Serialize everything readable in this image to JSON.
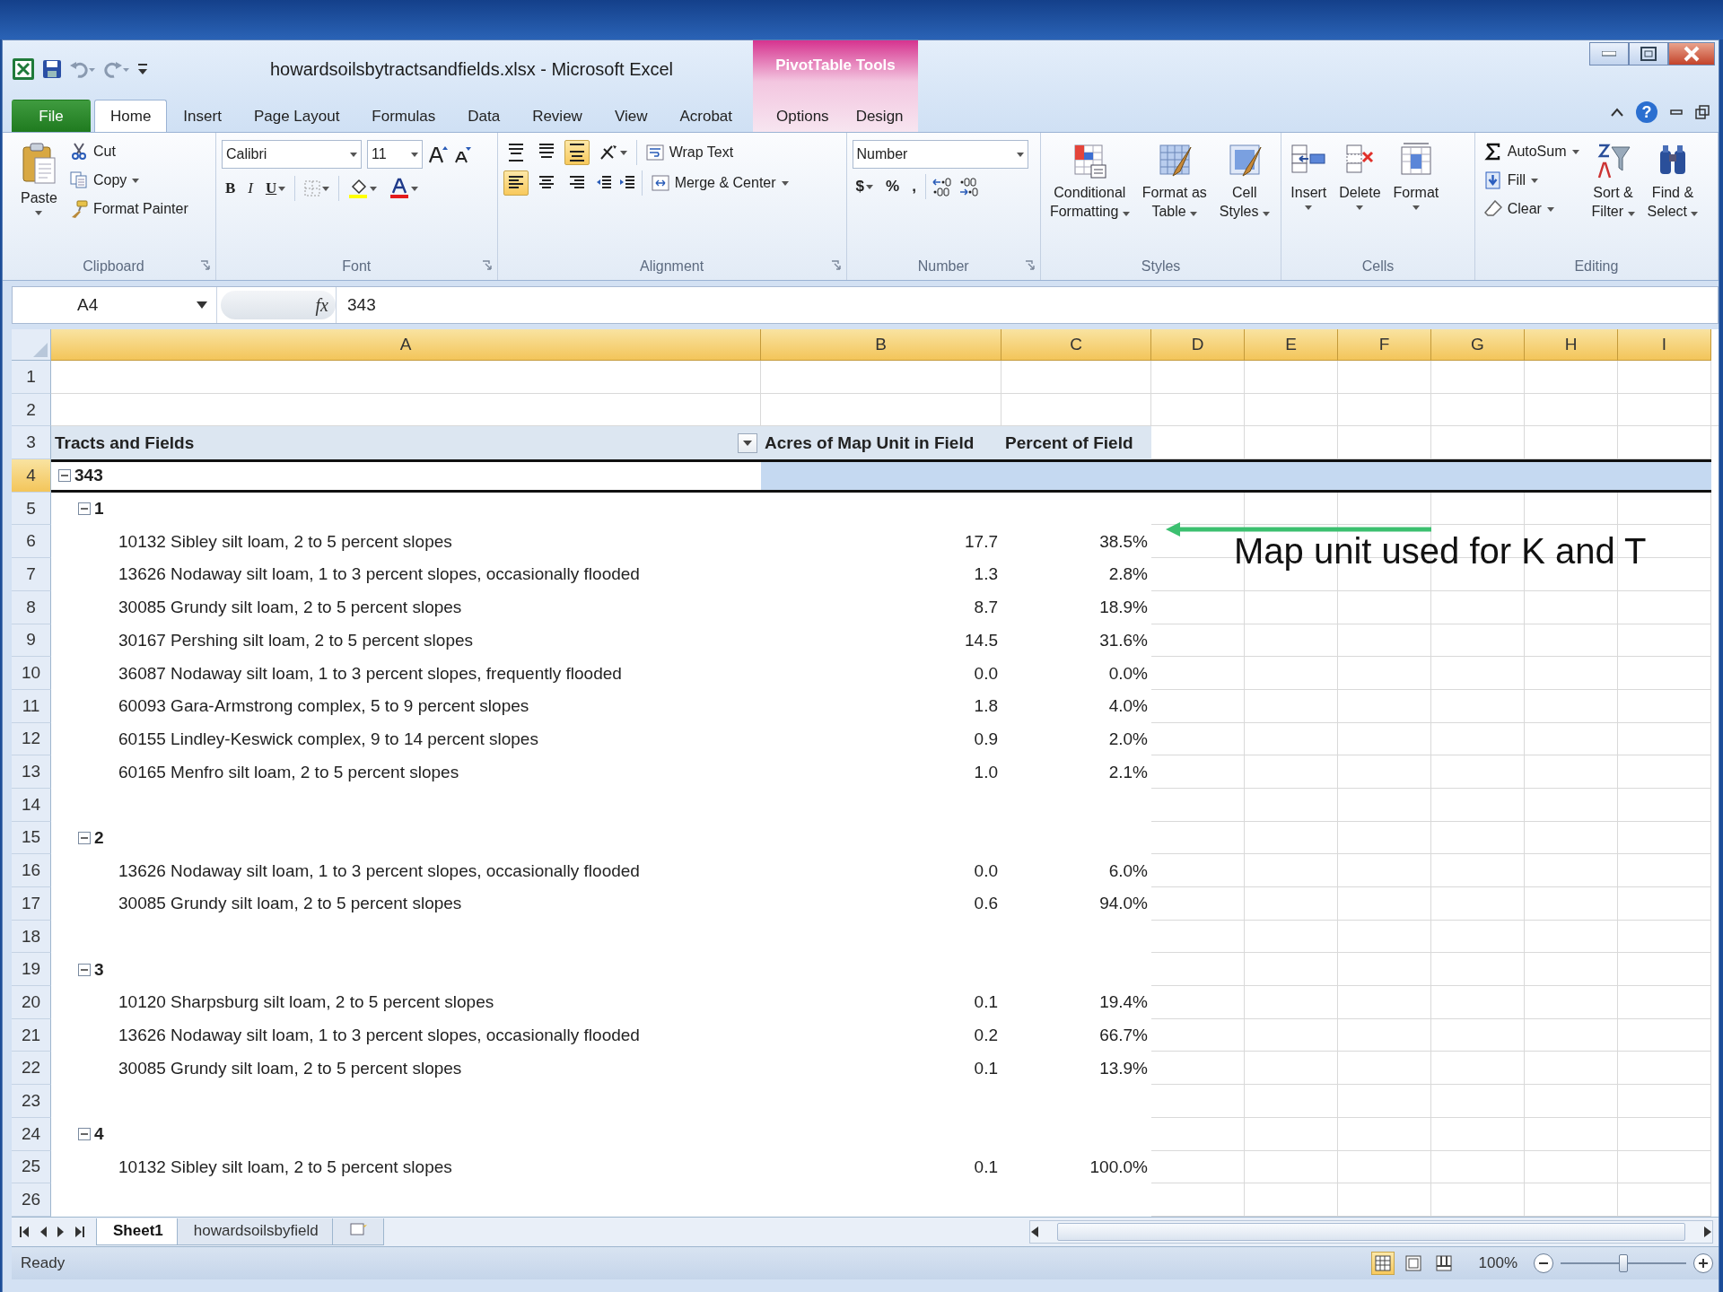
{
  "app": {
    "title": "howardsoilsbytractsandfields.xlsx  -  Microsoft Excel",
    "context_group": "PivotTable Tools",
    "help": "?"
  },
  "ribbon_tabs": [
    {
      "label": "File",
      "kind": "file",
      "selected": false
    },
    {
      "label": "Home",
      "kind": "tab",
      "selected": true
    },
    {
      "label": "Insert",
      "kind": "tab",
      "selected": false
    },
    {
      "label": "Page Layout",
      "kind": "tab",
      "selected": false
    },
    {
      "label": "Formulas",
      "kind": "tab",
      "selected": false
    },
    {
      "label": "Data",
      "kind": "tab",
      "selected": false
    },
    {
      "label": "Review",
      "kind": "tab",
      "selected": false
    },
    {
      "label": "View",
      "kind": "tab",
      "selected": false
    },
    {
      "label": "Acrobat",
      "kind": "tab",
      "selected": false
    },
    {
      "label": "Options",
      "kind": "context",
      "selected": false
    },
    {
      "label": "Design",
      "kind": "context",
      "selected": false
    }
  ],
  "ribbon": {
    "clipboard": {
      "label": "Clipboard",
      "paste": "Paste",
      "commands": [
        {
          "label": "Cut",
          "kind": "cut",
          "dropdown": false
        },
        {
          "label": "Copy",
          "kind": "copy",
          "dropdown": true
        },
        {
          "label": "Format Painter",
          "kind": "painter",
          "dropdown": false
        }
      ]
    },
    "font": {
      "label": "Font",
      "font_name": "Calibri",
      "font_size": "11",
      "styles": [
        {
          "label": "B",
          "kind": "bold"
        },
        {
          "label": "I",
          "kind": "italic"
        },
        {
          "label": "U",
          "kind": "underline"
        }
      ]
    },
    "alignment": {
      "label": "Alignment",
      "vertical": [
        {
          "kind": "top",
          "selected": false
        },
        {
          "kind": "middle",
          "selected": false
        },
        {
          "kind": "bottom",
          "selected": true
        }
      ],
      "horizontal": [
        {
          "kind": "left",
          "selected": true
        },
        {
          "kind": "center",
          "selected": false
        },
        {
          "kind": "right",
          "selected": false
        }
      ],
      "wrap_text": "Wrap Text",
      "merge_center": "Merge & Center"
    },
    "number": {
      "label": "Number",
      "format": "Number",
      "symbols": [
        "$",
        "%",
        ","
      ]
    },
    "styles": {
      "label": "Styles",
      "buttons": [
        {
          "kind": "conditional",
          "lines": [
            "Conditional",
            "Formatting"
          ]
        },
        {
          "kind": "table",
          "lines": [
            "Format as",
            "Table"
          ]
        },
        {
          "kind": "cellstyles",
          "lines": [
            "Cell",
            "Styles"
          ]
        }
      ]
    },
    "cells": {
      "label": "Cells",
      "buttons": [
        {
          "kind": "insert",
          "label": "Insert"
        },
        {
          "kind": "delete",
          "label": "Delete"
        },
        {
          "kind": "format",
          "label": "Format"
        }
      ]
    },
    "editing": {
      "label": "Editing",
      "commands": [
        {
          "kind": "autosum",
          "label": "AutoSum"
        },
        {
          "kind": "fill",
          "label": "Fill"
        },
        {
          "kind": "clear",
          "label": "Clear"
        }
      ],
      "buttons": [
        {
          "kind": "sort",
          "lines": [
            "Sort &",
            "Filter"
          ]
        },
        {
          "kind": "find",
          "lines": [
            "Find &",
            "Select"
          ]
        }
      ]
    }
  },
  "formula_bar": {
    "name_box": "A4",
    "function_button": "fx",
    "value": "343"
  },
  "grid": {
    "columns": [
      {
        "label": "A",
        "selected": true
      },
      {
        "label": "B",
        "selected": true
      },
      {
        "label": "C",
        "selected": true
      },
      {
        "label": "D",
        "selected": true
      },
      {
        "label": "E",
        "selected": true
      },
      {
        "label": "F",
        "selected": true
      },
      {
        "label": "G",
        "selected": true
      },
      {
        "label": "H",
        "selected": true
      },
      {
        "label": "I",
        "selected": true
      }
    ],
    "row_numbers": [
      "1",
      "2",
      "3",
      "4",
      "5",
      "6",
      "7",
      "8",
      "9",
      "10",
      "11",
      "12",
      "13",
      "14",
      "15",
      "16",
      "17",
      "18",
      "19",
      "20",
      "21",
      "22",
      "23",
      "24",
      "25",
      "26"
    ]
  },
  "pivot": {
    "headers": [
      "Tracts and Fields",
      "Acres of Map Unit in Field",
      "Percent of Field"
    ],
    "tracts": [
      {
        "label": "343",
        "expanded": true,
        "selected": true,
        "children": [
          {
            "label": "1",
            "expanded": true,
            "selected": false,
            "children": [
              {
                "label": "10132 Sibley silt loam, 2 to 5 percent slopes",
                "acres": "17.7",
                "percent": "38.5%",
                "selected": false
              },
              {
                "label": "13626 Nodaway silt loam, 1 to 3 percent slopes, occasionally flooded",
                "acres": "1.3",
                "percent": "2.8%",
                "selected": false
              },
              {
                "label": "30085 Grundy silt loam, 2 to 5 percent slopes",
                "acres": "8.7",
                "percent": "18.9%",
                "selected": false
              },
              {
                "label": "30167 Pershing silt loam, 2 to 5 percent slopes",
                "acres": "14.5",
                "percent": "31.6%",
                "selected": false
              },
              {
                "label": "36087 Nodaway silt loam, 1 to 3 percent slopes, frequently flooded",
                "acres": "0.0",
                "percent": "0.0%",
                "selected": false
              },
              {
                "label": "60093 Gara-Armstrong complex, 5 to 9 percent slopes",
                "acres": "1.8",
                "percent": "4.0%",
                "selected": false
              },
              {
                "label": "60155 Lindley-Keswick complex, 9 to 14 percent slopes",
                "acres": "0.9",
                "percent": "2.0%",
                "selected": false
              },
              {
                "label": "60165 Menfro silt loam, 2 to 5 percent slopes",
                "acres": "1.0",
                "percent": "2.1%",
                "selected": false
              }
            ]
          },
          {
            "label": "2",
            "expanded": true,
            "selected": false,
            "children": [
              {
                "label": "13626 Nodaway silt loam, 1 to 3 percent slopes, occasionally flooded",
                "acres": "0.0",
                "percent": "6.0%",
                "selected": false
              },
              {
                "label": "30085 Grundy silt loam, 2 to 5 percent slopes",
                "acres": "0.6",
                "percent": "94.0%",
                "selected": false
              }
            ]
          },
          {
            "label": "3",
            "expanded": true,
            "selected": false,
            "children": [
              {
                "label": "10120 Sharpsburg silt loam, 2 to 5 percent slopes",
                "acres": "0.1",
                "percent": "19.4%",
                "selected": false
              },
              {
                "label": "13626 Nodaway silt loam, 1 to 3 percent slopes, occasionally flooded",
                "acres": "0.2",
                "percent": "66.7%",
                "selected": false
              },
              {
                "label": "30085 Grundy silt loam, 2 to 5 percent slopes",
                "acres": "0.1",
                "percent": "13.9%",
                "selected": false
              }
            ]
          },
          {
            "label": "4",
            "expanded": true,
            "selected": false,
            "children": [
              {
                "label": "10132 Sibley silt loam, 2 to 5 percent slopes",
                "acres": "0.1",
                "percent": "100.0%",
                "selected": false
              }
            ]
          }
        ]
      }
    ]
  },
  "annotation": {
    "text": "Map unit used for K and T"
  },
  "sheet_tabs": [
    {
      "label": "Sheet1",
      "selected": true
    },
    {
      "label": "howardsoilsbyfield",
      "selected": false
    }
  ],
  "status_bar": {
    "status": "Ready",
    "views": [
      {
        "kind": "normal",
        "selected": true
      },
      {
        "kind": "layout",
        "selected": false
      },
      {
        "kind": "pagebreak",
        "selected": false
      }
    ],
    "zoom": "100%",
    "zoom_slider": {
      "level": 0.5
    }
  }
}
